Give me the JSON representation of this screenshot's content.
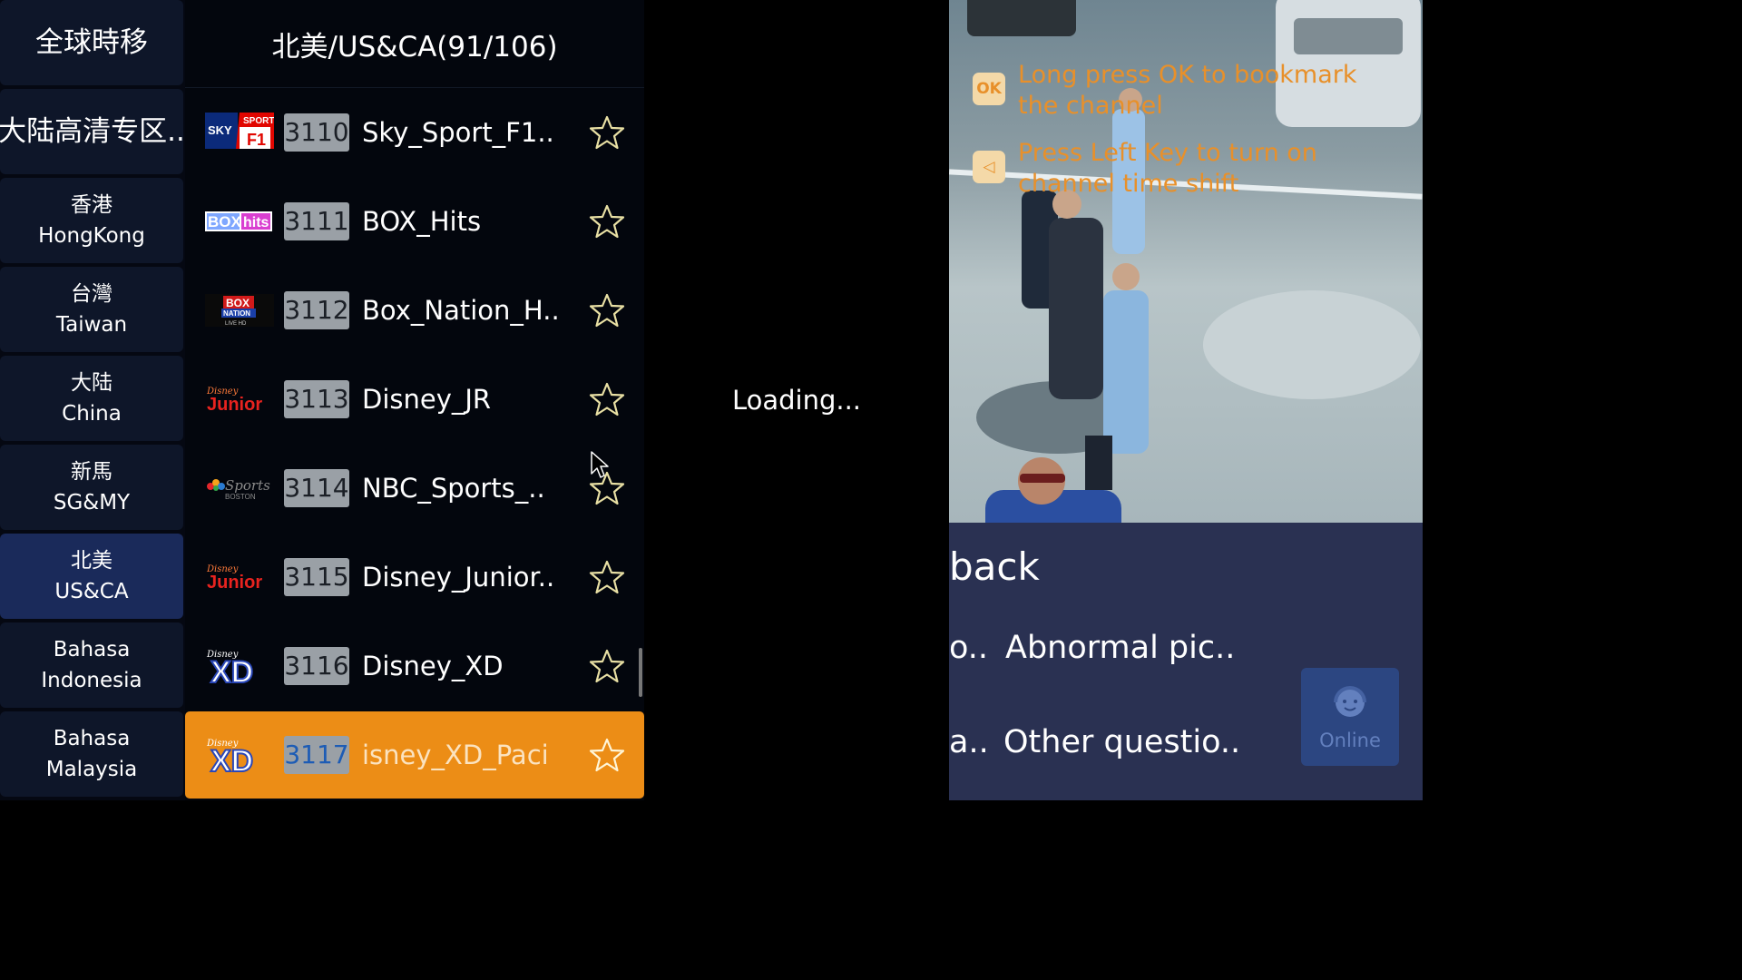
{
  "categories": [
    {
      "line1": "全球時移",
      "line2": "",
      "active": false
    },
    {
      "line1": "大陆高清专区..",
      "line2": "",
      "active": false
    },
    {
      "line1": "香港",
      "line2": "HongKong",
      "active": false
    },
    {
      "line1": "台灣",
      "line2": "Taiwan",
      "active": false
    },
    {
      "line1": "大陆",
      "line2": "China",
      "active": false
    },
    {
      "line1": "新馬",
      "line2": "SG&MY",
      "active": false
    },
    {
      "line1": "北美",
      "line2": "US&CA",
      "active": true
    },
    {
      "line1": "Bahasa",
      "line2": "Indonesia",
      "active": false
    },
    {
      "line1": "Bahasa",
      "line2": "Malaysia",
      "active": false
    }
  ],
  "list_title": "北美/US&CA(91/106)",
  "channels": [
    {
      "number": "3110",
      "name": "Sky_Sport_F1..",
      "logo": "sky-sport-f1-logo",
      "selected": false
    },
    {
      "number": "3111",
      "name": "BOX_Hits",
      "logo": "box-hits-logo",
      "selected": false
    },
    {
      "number": "3112",
      "name": "Box_Nation_H..",
      "logo": "box-nation-logo",
      "selected": false
    },
    {
      "number": "3113",
      "name": "Disney_JR",
      "logo": "disney-junior-logo",
      "selected": false
    },
    {
      "number": "3114",
      "name": "NBC_Sports_..",
      "logo": "nbc-sports-boston-logo",
      "selected": false
    },
    {
      "number": "3115",
      "name": "Disney_Junior..",
      "logo": "disney-junior-logo",
      "selected": false
    },
    {
      "number": "3116",
      "name": "Disney_XD",
      "logo": "disney-xd-logo",
      "selected": false
    },
    {
      "number": "3117",
      "name": "isney_XD_Paci",
      "logo": "disney-xd-logo",
      "selected": true
    }
  ],
  "loading_text": "Loading...",
  "hints": [
    {
      "icon": "OK",
      "text": "Long press OK to bookmark the channel"
    },
    {
      "icon": "◁",
      "text": "Press Left Key to turn on channel time shift"
    }
  ],
  "feedback": {
    "title": "back",
    "options": [
      {
        "prefix": "o..",
        "label": "Abnormal pic.."
      },
      {
        "prefix": "a..",
        "label": "Other questio.."
      }
    ],
    "online_label": "Online"
  },
  "colors": {
    "selected_row": "#ec8d16",
    "hint_text": "#e8902a",
    "active_category": "#1a2a5a",
    "feedback_bg": "#2a3152"
  }
}
